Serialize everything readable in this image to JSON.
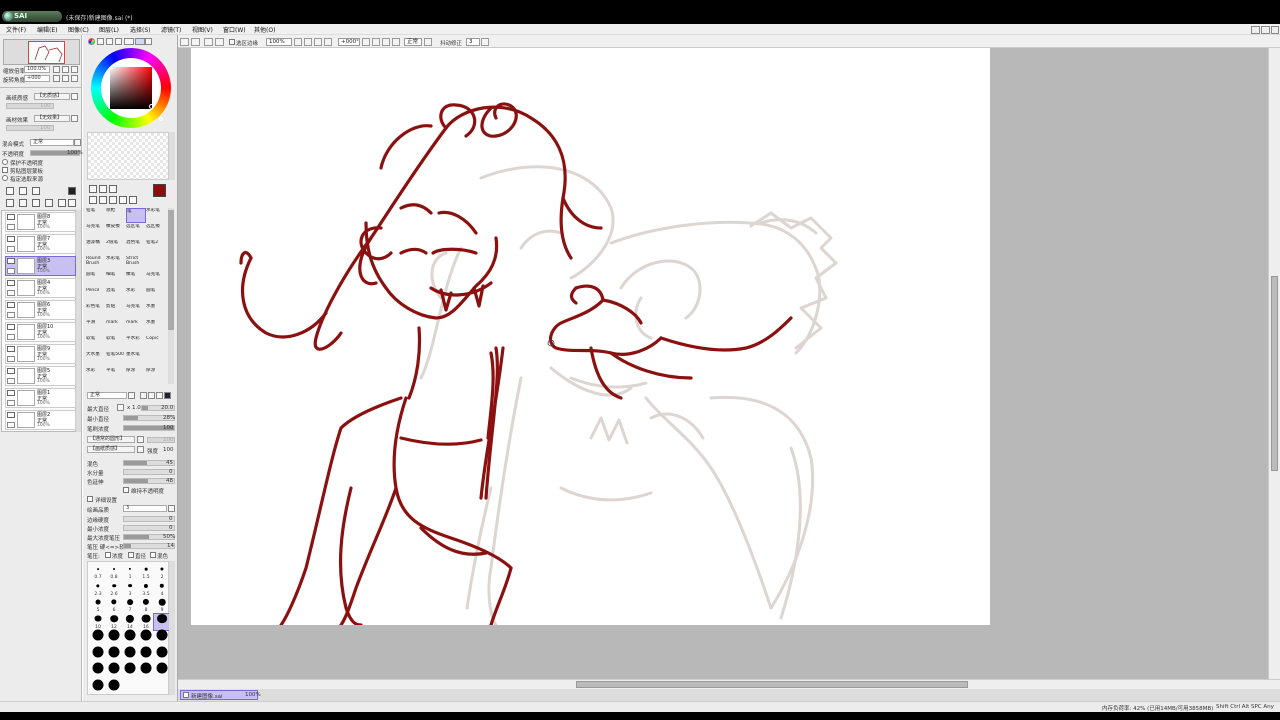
{
  "window": {
    "title": "(未保存)新建图像.sai (*)",
    "logo_text": "SAI"
  },
  "menu": [
    "文件(F)",
    "编辑(E)",
    "图像(C)",
    "图层(L)",
    "选择(S)",
    "滤镜(T)",
    "视图(V)",
    "窗口(W)",
    "其他(O)"
  ],
  "navigator": {
    "zoom_label": "缩放倍率",
    "zoom_value": "100.0%",
    "angle_label": "旋转角度",
    "angle_value": "+000"
  },
  "layer_props": {
    "paper_label": "画纸质感",
    "paper_value": "【无质感】",
    "paper_strength": "100",
    "effect_label": "画材效果",
    "effect_value": "【无效果】",
    "effect_strength": "100",
    "blend_label": "混合模式",
    "blend_value": "正常",
    "opacity_label": "不透明度",
    "opacity_value": "100%",
    "opacity_level": 1.0,
    "checks": [
      "保护不透明度",
      "剪贴图层蒙板",
      "指定选取来源"
    ]
  },
  "layers": [
    {
      "name": "图层8",
      "mode": "正常",
      "opacity": "100%",
      "selected": false
    },
    {
      "name": "图层7",
      "mode": "正常",
      "opacity": "100%",
      "selected": false
    },
    {
      "name": "图层3",
      "mode": "正常",
      "opacity": "100%",
      "selected": true
    },
    {
      "name": "图层4",
      "mode": "正常",
      "opacity": "100%",
      "selected": false
    },
    {
      "name": "图层6",
      "mode": "正常",
      "opacity": "100%",
      "selected": false
    },
    {
      "name": "图层10",
      "mode": "正常",
      "opacity": "100%",
      "selected": false
    },
    {
      "name": "图层9",
      "mode": "正常",
      "opacity": "100%",
      "selected": false
    },
    {
      "name": "图层5",
      "mode": "正常",
      "opacity": "100%",
      "selected": false
    },
    {
      "name": "图层1",
      "mode": "正常",
      "opacity": "100%",
      "selected": false
    },
    {
      "name": "图层2",
      "mode": "正常",
      "opacity": "100%",
      "selected": false
    }
  ],
  "colors": {
    "primary": "#8b0d0d",
    "line_red": "#8b1010",
    "sketch": "#ddd5d2",
    "selection": "#c8c0f0",
    "canvas_bg": "#b8b8b8"
  },
  "tools": [
    [
      "铅笔",
      "喷枪",
      "笔",
      "水彩笔"
    ],
    [
      "马克笔",
      "橡皮擦",
      "选区笔",
      "选区擦"
    ],
    [
      "油漆桶",
      "2值笔",
      "混色笔",
      "铅笔2"
    ],
    [
      "Round Brush",
      "水彩笔",
      "Strict Brush",
      ""
    ],
    [
      "圆笔",
      "细笔",
      "橡笔",
      "马克笔"
    ],
    [
      "Pencil",
      "混笔",
      "水彩",
      "圆笔"
    ],
    [
      "彩色笔",
      "剪贴",
      "马克笔",
      "水墨"
    ],
    [
      "平滑",
      "mark",
      "mark",
      "水墨"
    ],
    [
      "软笔",
      "软笔",
      "平水彩",
      "Copic"
    ],
    [
      "大水墨",
      "铅笔500",
      "墨水笔",
      ""
    ],
    [
      "水彩",
      "平笔",
      "厚涂",
      "厚涂"
    ]
  ],
  "brush": {
    "blend_mode": "正常",
    "max_size_label": "最大直径",
    "max_size_mult": "x 1.0",
    "max_size_value": "20.0",
    "min_size_label": "最小直径",
    "min_size_value": "28%",
    "density_label": "笔刷浓度",
    "density_value": "100",
    "shape_value": "【通常的圆形】",
    "shape_strength": "100",
    "texture_value": "【画纸质感】",
    "texture_strength_label": "强度",
    "texture_strength": "100",
    "blend_label": "混色",
    "blend_value": "45",
    "water_label": "水分量",
    "water_value": "0",
    "persist_label": "色延伸",
    "persist_value": "48",
    "keep_opacity_label": "维持不透明度",
    "detail_label": "详细设置",
    "quality_label": "绘画品质",
    "quality_value": "3",
    "edge_label": "边缘硬度",
    "edge_value": "0",
    "min_density_label": "最小浓度",
    "min_density_value": "0",
    "pressure_label": "最大浓度笔压",
    "pressure_value": "50%",
    "pressure_hard_label": "笔压 硬<=>软",
    "pressure_hard_value": "14",
    "pressure_opts_label": "笔压:",
    "pressure_opts": [
      "浓度",
      "直径",
      "混色"
    ]
  },
  "brush_sizes": [
    "0.7",
    "0.8",
    "1",
    "1.5",
    "2",
    "2.3",
    "2.6",
    "3",
    "3.5",
    "4",
    "5",
    "6",
    "7",
    "8",
    "9",
    "10",
    "12",
    "14",
    "16",
    "20",
    "25",
    "30",
    "35",
    "40",
    "50",
    "60",
    "70",
    "80",
    "100",
    "120",
    "160",
    "200",
    "250",
    "300",
    "350",
    "400",
    "500"
  ],
  "toolbar": {
    "select_edge": "选区边缘",
    "zoom": "100%",
    "angle": "+000°",
    "blend": "正常",
    "stabilizer_label": "抖动修正",
    "stabilizer_value": "3"
  },
  "document_tab": {
    "name": "新建图像.sai",
    "zoom": "100%"
  },
  "status": {
    "memory": "内存负荷率: 42% (已用14MB/可用3858MB)",
    "keys": "Shift Ctrl Alt SPC Any"
  }
}
